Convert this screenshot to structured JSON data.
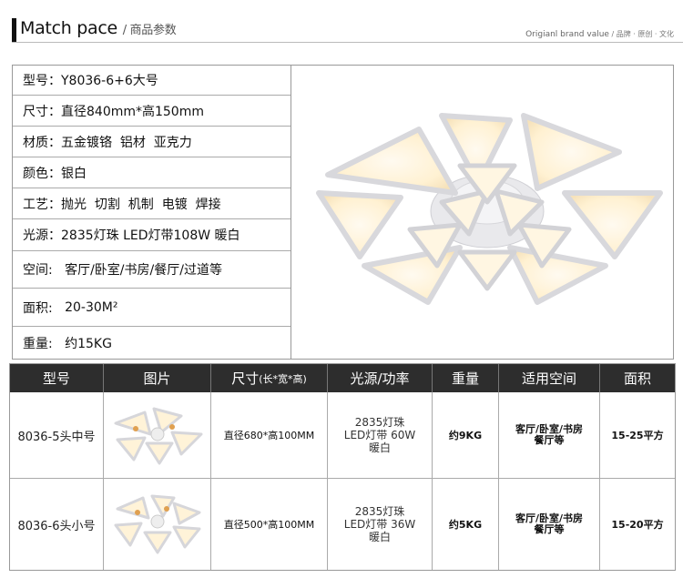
{
  "header": {
    "title": "Match pace",
    "subtitle": " / 商品参数",
    "right_main": "Origianl brand value",
    "right_tail": " / 品牌 · 原创 · 文化"
  },
  "specs": [
    {
      "key": "型号：",
      "value": "Y8036-6+6大号"
    },
    {
      "key": "尺寸：",
      "value": "直径840mm*高150mm"
    },
    {
      "key": "材质：",
      "value": "五金镀铬  铝材  亚克力"
    },
    {
      "key": "颜色：",
      "value": "银白"
    },
    {
      "key": "工艺：",
      "value": "抛光  切割  机制  电镀  焊接"
    },
    {
      "key": "光源：",
      "value": "2835灯珠 LED灯带108W 暖白"
    },
    {
      "key": "空间:   ",
      "value": "客厅/卧室/书房/餐厅/过道等"
    },
    {
      "key": "面积:   ",
      "value": "20-30M²"
    },
    {
      "key": "重量:   ",
      "value": "约15KG"
    }
  ],
  "table": {
    "headers": {
      "model": "型号",
      "image": "图片",
      "size": "尺寸",
      "size_note": "(长*宽*高)",
      "light": "光源/功率",
      "weight": "重量",
      "space": "适用空间",
      "area": "面积"
    },
    "rows": [
      {
        "model": "8036-5头中号",
        "size": "直径680*高100MM",
        "light": [
          "2835灯珠",
          "LED灯带 60W",
          "暖白"
        ],
        "weight": "约9KG",
        "space": [
          "客厅/卧室/书房",
          "餐厅等"
        ],
        "area": "15-25平方"
      },
      {
        "model": "8036-6头小号",
        "size": "直径500*高100MM",
        "light": [
          "2835灯珠",
          "LED灯带 36W",
          "暖白"
        ],
        "weight": "约5KG",
        "space": [
          "客厅/卧室/书房",
          "餐厅等"
        ],
        "area": "15-20平方"
      }
    ]
  },
  "colors": {
    "table_header_bg": "#2d2d2d",
    "lamp_frame": "#e8e8ea",
    "lamp_glow": "#fff3d6"
  }
}
